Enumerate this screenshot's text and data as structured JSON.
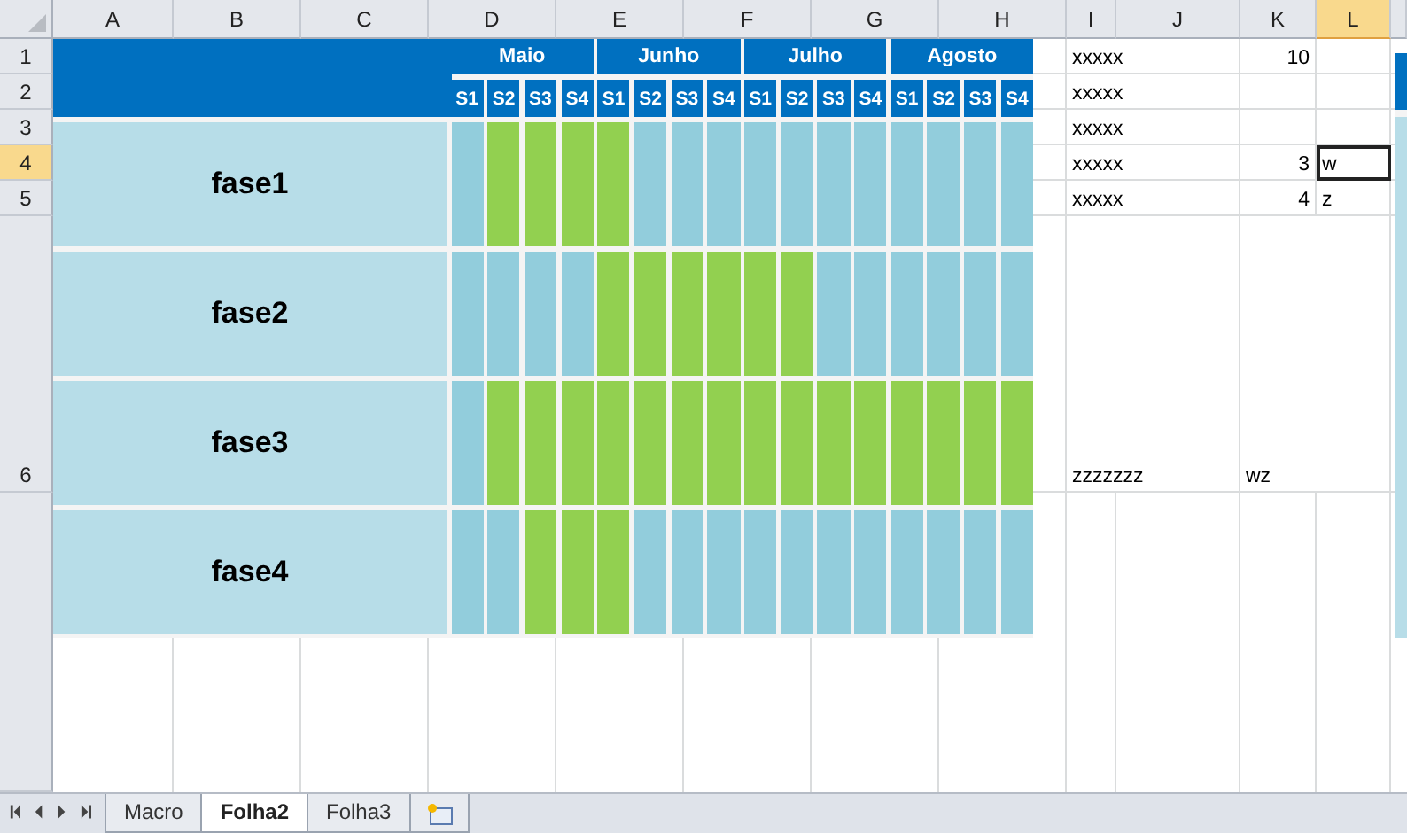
{
  "columns": [
    {
      "label": "A",
      "selected": false
    },
    {
      "label": "B",
      "selected": false
    },
    {
      "label": "C",
      "selected": false
    },
    {
      "label": "D",
      "selected": false
    },
    {
      "label": "E",
      "selected": false
    },
    {
      "label": "F",
      "selected": false
    },
    {
      "label": "G",
      "selected": false
    },
    {
      "label": "H",
      "selected": false
    },
    {
      "label": "I",
      "selected": false
    },
    {
      "label": "J",
      "selected": false
    },
    {
      "label": "K",
      "selected": false
    },
    {
      "label": "L",
      "selected": true
    }
  ],
  "rows": [
    {
      "label": "1",
      "selected": false,
      "cells": [
        null,
        null,
        null,
        null,
        null,
        null,
        null,
        null,
        {
          "text": "xxxxx",
          "kind": "text",
          "selected": false
        },
        null,
        {
          "text": "10",
          "kind": "number",
          "selected": false
        },
        null
      ]
    },
    {
      "label": "2",
      "selected": false,
      "cells": [
        null,
        null,
        null,
        null,
        null,
        null,
        null,
        null,
        {
          "text": "xxxxx",
          "kind": "text",
          "selected": false
        },
        null,
        null,
        null
      ]
    },
    {
      "label": "3",
      "selected": false,
      "cells": [
        null,
        null,
        null,
        null,
        null,
        null,
        null,
        null,
        {
          "text": "xxxxx",
          "kind": "text",
          "selected": false
        },
        null,
        null,
        null
      ]
    },
    {
      "label": "4",
      "selected": true,
      "cells": [
        null,
        null,
        null,
        null,
        null,
        null,
        null,
        null,
        {
          "text": "xxxxx",
          "kind": "text",
          "selected": false
        },
        null,
        {
          "text": "3",
          "kind": "number",
          "selected": false
        },
        {
          "text": "w",
          "kind": "text",
          "selected": true
        }
      ]
    },
    {
      "label": "5",
      "selected": false,
      "cells": [
        null,
        null,
        null,
        null,
        null,
        null,
        null,
        null,
        {
          "text": "xxxxx",
          "kind": "text",
          "selected": false
        },
        null,
        {
          "text": "4",
          "kind": "number",
          "selected": false
        },
        {
          "text": "z",
          "kind": "text",
          "selected": false
        }
      ]
    },
    {
      "label": "6",
      "selected": false,
      "cells": [
        null,
        null,
        null,
        null,
        null,
        null,
        null,
        null,
        {
          "text": "zzzzzzz",
          "kind": "text",
          "selected": false
        },
        null,
        {
          "text": "wz",
          "kind": "text",
          "selected": false
        },
        null
      ]
    }
  ],
  "gantt": {
    "months": [
      {
        "label": "Maio",
        "weeks": [
          "S1",
          "S2",
          "S3",
          "S4"
        ]
      },
      {
        "label": "Junho",
        "weeks": [
          "S1",
          "S2",
          "S3",
          "S4"
        ]
      },
      {
        "label": "Julho",
        "weeks": [
          "S1",
          "S2",
          "S3",
          "S4"
        ]
      },
      {
        "label": "Agosto",
        "weeks": [
          "S1",
          "S2",
          "S3",
          "S4"
        ]
      }
    ],
    "phases": [
      {
        "label": "fase1",
        "weeks": [
          false,
          true,
          true,
          true,
          true,
          false,
          false,
          false,
          false,
          false,
          false,
          false,
          false,
          false,
          false,
          false
        ]
      },
      {
        "label": "fase2",
        "weeks": [
          false,
          false,
          false,
          false,
          true,
          true,
          true,
          true,
          true,
          true,
          false,
          false,
          false,
          false,
          false,
          false
        ]
      },
      {
        "label": "fase3",
        "weeks": [
          false,
          true,
          true,
          true,
          true,
          true,
          true,
          true,
          true,
          true,
          true,
          true,
          true,
          true,
          true,
          true
        ]
      },
      {
        "label": "fase4",
        "weeks": [
          false,
          false,
          true,
          true,
          true,
          false,
          false,
          false,
          false,
          false,
          false,
          false,
          false,
          false,
          false,
          false
        ]
      }
    ]
  },
  "sheet_tabs": [
    {
      "label": "Macro",
      "selected": false
    },
    {
      "label": "Folha2",
      "selected": true
    },
    {
      "label": "Folha3",
      "selected": false
    }
  ]
}
